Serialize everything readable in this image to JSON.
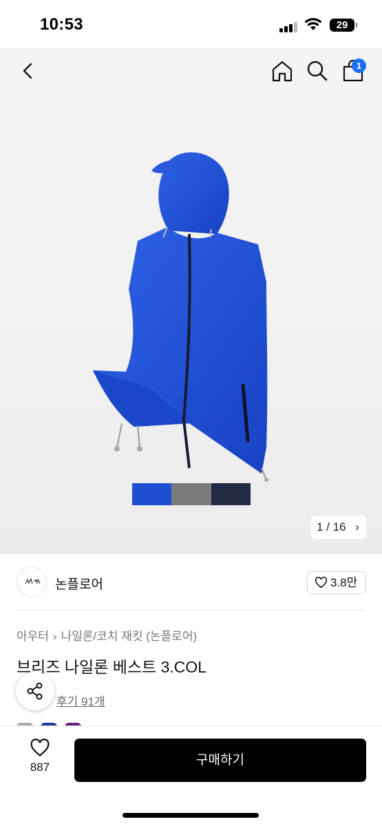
{
  "status_bar": {
    "time": "10:53",
    "battery": "29"
  },
  "nav": {
    "cart_count": "1",
    "icons": [
      "back-icon",
      "home-icon",
      "search-icon",
      "cart-icon"
    ]
  },
  "hero": {
    "swatch_colors": [
      "#1f4fd1",
      "#7a7a7a",
      "#232a43"
    ],
    "page_indicator": "1 / 16",
    "page_chevron": "›"
  },
  "shop": {
    "name": "논플로어",
    "likes": "3.8만"
  },
  "product": {
    "breadcrumb": [
      "아우터",
      "나일론/코치 재킷 (논플로어)"
    ],
    "breadcrumb_separator": "›",
    "title": "브리즈 나일론 베스트 3.COL",
    "review_link": "후기 91개"
  },
  "bottom_bar": {
    "wish_count": "887",
    "buy_label": "구매하기"
  },
  "colors": {
    "accent_badge": "#1a6ff5",
    "buy_button": "#000000"
  }
}
